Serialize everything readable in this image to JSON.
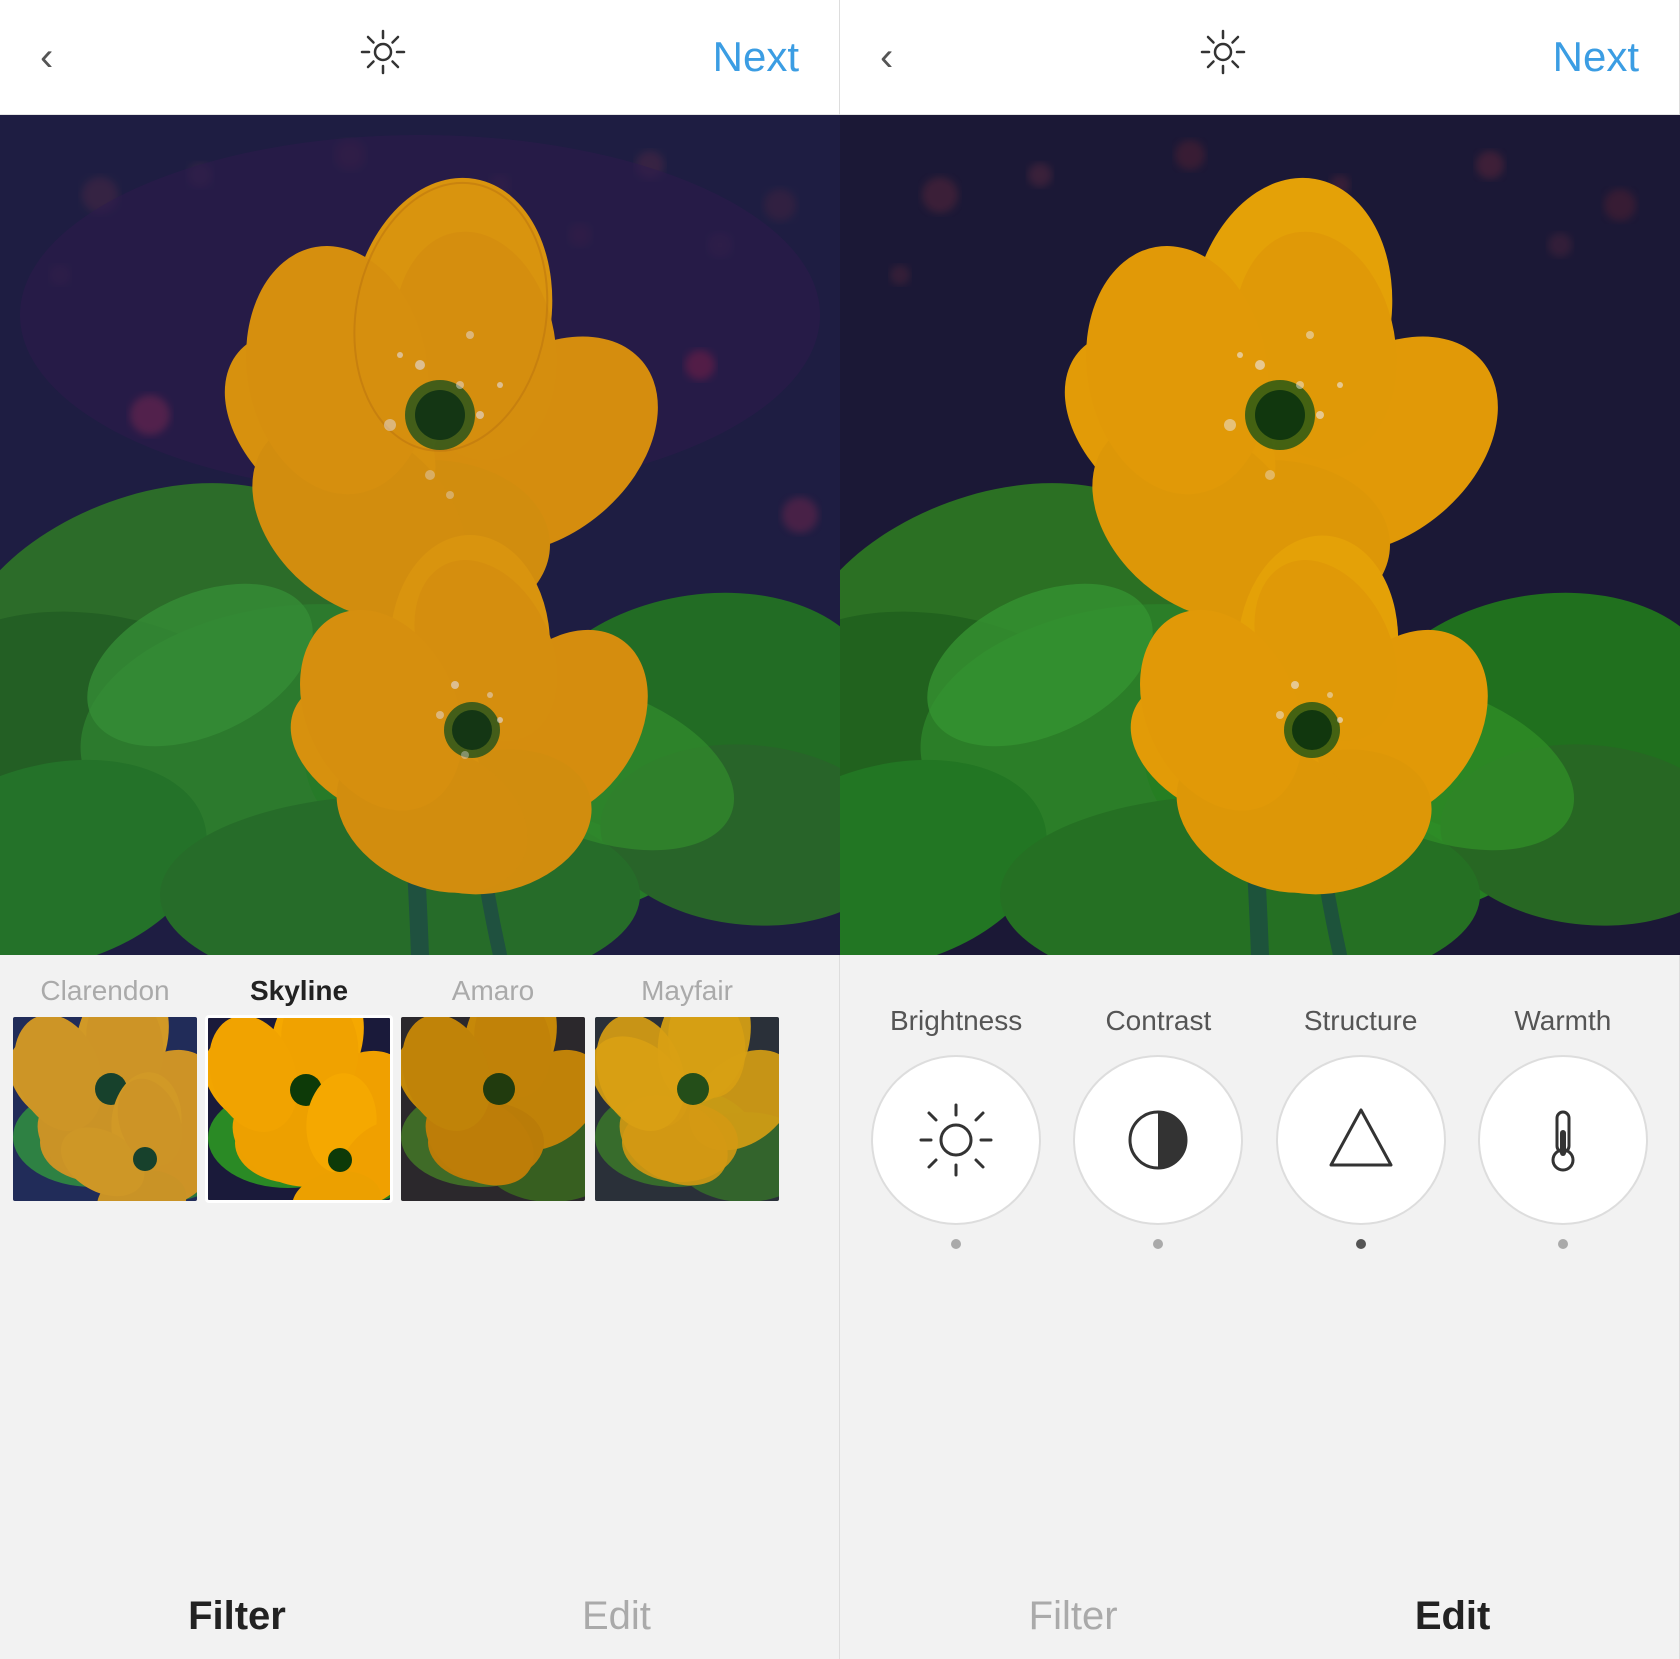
{
  "left_panel": {
    "header": {
      "back_label": "‹",
      "next_label": "Next"
    },
    "filters": [
      {
        "label": "Clarendon",
        "active": false
      },
      {
        "label": "Skyline",
        "active": true
      },
      {
        "label": "Amaro",
        "active": false
      },
      {
        "label": "Mayfair",
        "active": false
      }
    ],
    "tabs": [
      {
        "label": "Filter",
        "active": true
      },
      {
        "label": "Edit",
        "active": false
      }
    ]
  },
  "right_panel": {
    "header": {
      "back_label": "‹",
      "next_label": "Next"
    },
    "tools": [
      {
        "label": "Brightness",
        "icon": "sun",
        "has_dot": false
      },
      {
        "label": "Contrast",
        "icon": "half-circle",
        "has_dot": false
      },
      {
        "label": "Structure",
        "icon": "triangle",
        "has_dot": true
      },
      {
        "label": "Warmth",
        "icon": "thermometer",
        "has_dot": false
      }
    ],
    "tabs": [
      {
        "label": "Filter",
        "active": false
      },
      {
        "label": "Edit",
        "active": true
      }
    ]
  },
  "colors": {
    "accent_blue": "#3b9de3",
    "active_label": "#222222",
    "inactive_label": "#aaaaaa",
    "circle_border": "#dddddd",
    "dot_active": "#555555"
  }
}
